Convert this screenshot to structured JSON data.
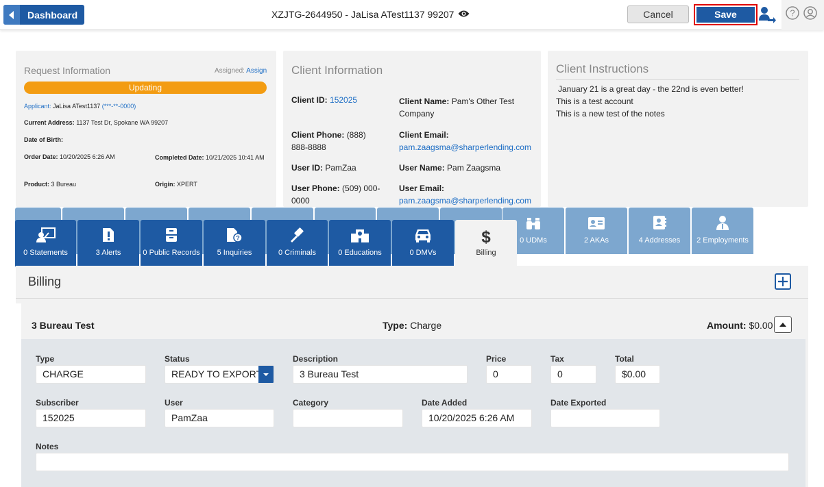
{
  "topbar": {
    "dashboard_label": "Dashboard",
    "title": "XZJTG-2644950 - JaLisa ATest1137 99207",
    "cancel_label": "Cancel",
    "save_label": "Save"
  },
  "request_info": {
    "heading": "Request Information",
    "assigned_label": "Assigned:",
    "assign_link": "Assign",
    "status": "Updating",
    "applicant_label": "Applicant:",
    "applicant_name": "JaLisa ATest1137",
    "applicant_ssn": "(***-**-0000)",
    "address_label": "Current Address:",
    "address": "1137 Test Dr, Spokane WA 99207",
    "dob_label": "Date of Birth:",
    "order_date_label": "Order Date:",
    "order_date": "10/20/2025 6:26 AM",
    "completed_label": "Completed Date:",
    "completed_date": "10/21/2025 10:41 AM",
    "product_label": "Product:",
    "product": "3 Bureau",
    "origin_label": "Origin:",
    "origin": "XPERT"
  },
  "client_info": {
    "heading": "Client Information",
    "client_id_label": "Client ID:",
    "client_id": "152025",
    "client_name_label": "Client Name:",
    "client_name": "Pam's Other Test Company",
    "client_phone_label": "Client Phone:",
    "client_phone": "(888) 888-8888",
    "client_email_label": "Client Email:",
    "client_email": "pam.zaagsma@sharperlending.com",
    "user_id_label": "User ID:",
    "user_id": "PamZaa",
    "user_name_label": "User Name:",
    "user_name": "Pam Zaagsma",
    "user_phone_label": "User Phone:",
    "user_phone": "(509) 000-0000",
    "user_email_label": "User Email:",
    "user_email": "pam.zaagsma@sharperlending.com"
  },
  "client_instructions": {
    "heading": "Client Instructions",
    "line1": "January 21 is a great day - the 22nd is even better!",
    "line2": "This is a test account",
    "line3": "This is a new test of the notes"
  },
  "tabs_back": [
    {
      "label": "0 UDMs",
      "icon": "binoculars-icon"
    },
    {
      "label": "2 AKAs",
      "icon": "id-card-icon"
    },
    {
      "label": "4 Addresses",
      "icon": "address-book-icon"
    },
    {
      "label": "2 Employments",
      "icon": "employee-icon"
    }
  ],
  "tabs_front": [
    {
      "label": "0 Statements",
      "icon": "statement-icon"
    },
    {
      "label": "3 Alerts",
      "icon": "alert-icon"
    },
    {
      "label": "0 Public Records",
      "icon": "cabinet-icon"
    },
    {
      "label": "5 Inquiries",
      "icon": "inquiry-icon"
    },
    {
      "label": "0 Criminals",
      "icon": "gavel-icon"
    },
    {
      "label": "0 Educations",
      "icon": "school-icon"
    },
    {
      "label": "0 DMVs",
      "icon": "car-icon"
    },
    {
      "label": "Billing",
      "icon": "dollar-icon",
      "active": true
    }
  ],
  "billing": {
    "heading": "Billing",
    "item_name": "3 Bureau Test",
    "type_label": "Type:",
    "type_value": "Charge",
    "amount_label": "Amount:",
    "amount_value": "$0.00",
    "fields": {
      "type_label": "Type",
      "type_value": "CHARGE",
      "status_label": "Status",
      "status_value": "READY TO EXPORT",
      "description_label": "Description",
      "description_value": "3 Bureau Test",
      "price_label": "Price",
      "price_value": "0",
      "tax_label": "Tax",
      "tax_value": "0",
      "total_label": "Total",
      "total_value": "$0.00",
      "subscriber_label": "Subscriber",
      "subscriber_value": "152025",
      "user_label": "User",
      "user_value": "PamZaa",
      "category_label": "Category",
      "category_value": "",
      "date_added_label": "Date Added",
      "date_added_value": "10/20/2025 6:26 AM",
      "date_exported_label": "Date Exported",
      "date_exported_value": "",
      "notes_label": "Notes",
      "notes_value": ""
    }
  },
  "colors": {
    "primary": "#1e5aa3",
    "status_bar": "#f39c12",
    "back_tab": "#7da7cf",
    "save_highlight": "#e00000"
  }
}
